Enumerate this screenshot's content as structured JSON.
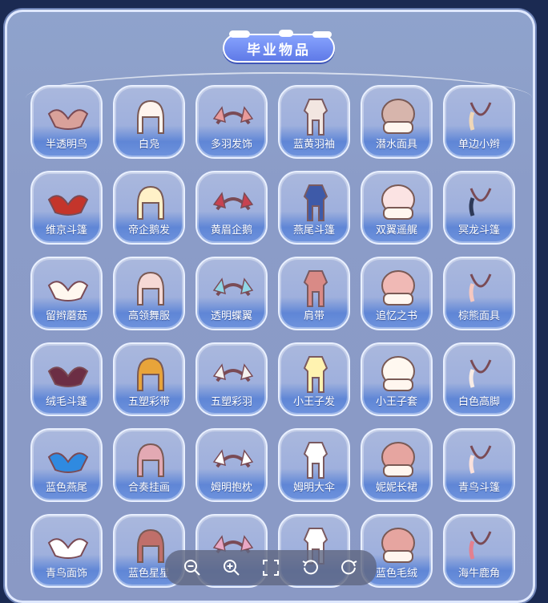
{
  "panel": {
    "title": "毕业物品"
  },
  "items": [
    {
      "label": "半透明鸟",
      "icon": "translucent-bird-icon",
      "color": "#d9a19a"
    },
    {
      "label": "白凫",
      "icon": "white-hair-icon",
      "color": "#fff5ee"
    },
    {
      "label": "多羽发饰",
      "icon": "feather-headband-icon",
      "color": "#e89a9a"
    },
    {
      "label": "蓝黄羽袖",
      "icon": "outfit-icon",
      "color": "#f2e6e1"
    },
    {
      "label": "潜水面具",
      "icon": "diving-mask-icon",
      "color": "#d7b5ac"
    },
    {
      "label": "单边小辫",
      "icon": "braid-icon",
      "color": "#f0d7b7"
    },
    {
      "label": "维京斗篷",
      "icon": "cape-icon",
      "color": "#c4352b"
    },
    {
      "label": "帝企鹅发",
      "icon": "hair-icon",
      "color": "#fff1c8"
    },
    {
      "label": "黄眉企鹅",
      "icon": "penguin-mask-icon",
      "color": "#c84250"
    },
    {
      "label": "燕尾斗篷",
      "icon": "swallowtail-cape-icon",
      "color": "#3e5aa8"
    },
    {
      "label": "双翼遥艉",
      "icon": "wing-cape-icon",
      "color": "#fbe3e3"
    },
    {
      "label": "冥龙斗篷",
      "icon": "dragon-cape-icon",
      "color": "#2d3958"
    },
    {
      "label": "留辫蘑菇",
      "icon": "mushroom-hair-icon",
      "color": "#fff8ef"
    },
    {
      "label": "高领舞服",
      "icon": "dance-outfit-icon",
      "color": "#f6d9d5"
    },
    {
      "label": "透明蝶翼",
      "icon": "butterfly-wings-icon",
      "color": "#8fd6e6"
    },
    {
      "label": "肩带",
      "icon": "shoulder-strap-icon",
      "color": "#d98a86"
    },
    {
      "label": "追忆之书",
      "icon": "book-icon",
      "color": "#f0b9b5"
    },
    {
      "label": "棕熊面具",
      "icon": "bear-mask-icon",
      "color": "#f6c8c0"
    },
    {
      "label": "绒毛斗篷",
      "icon": "fur-cape-icon",
      "color": "#6c2e44"
    },
    {
      "label": "五塑彩带",
      "icon": "ribbon-icon",
      "color": "#e8a43a"
    },
    {
      "label": "五塑彩羽",
      "icon": "feather-hair-icon",
      "color": "#f4f1ee"
    },
    {
      "label": "小王子发",
      "icon": "little-prince-hair-icon",
      "color": "#fff3b0"
    },
    {
      "label": "小王子套",
      "icon": "little-prince-outfit-icon",
      "color": "#fff8f0"
    },
    {
      "label": "白色高脚",
      "icon": "piano-icon",
      "color": "#f8ece6"
    },
    {
      "label": "蓝色燕尾",
      "icon": "blue-swallowtail-icon",
      "color": "#2f8ae0"
    },
    {
      "label": "合奏挂画",
      "icon": "painting-icon",
      "color": "#e3a9b3"
    },
    {
      "label": "姆明抱枕",
      "icon": "moomin-pillow-icon",
      "color": "#ffffff"
    },
    {
      "label": "姆明大伞",
      "icon": "umbrella-icon",
      "color": "#ffffff"
    },
    {
      "label": "妮妮长裙",
      "icon": "dress-icon",
      "color": "#e6a5a0"
    },
    {
      "label": "青鸟斗篷",
      "icon": "bluebird-cape-icon",
      "color": "#fae1dc"
    },
    {
      "label": "青鸟面饰",
      "icon": "bluebird-face-icon",
      "color": "#ffffff"
    },
    {
      "label": "蓝色星星",
      "icon": "star-accessory-icon",
      "color": "#c06f6a"
    },
    {
      "label": "",
      "icon": "cape-icon",
      "color": "#e9a7c4"
    },
    {
      "label": "",
      "icon": "scarf-icon",
      "color": "#ffffff"
    },
    {
      "label": "蓝色毛绒",
      "icon": "plush-outfit-icon",
      "color": "#e6a5a0"
    },
    {
      "label": "海牛鹿角",
      "icon": "antler-icon",
      "color": "#e3808f"
    }
  ],
  "toolbar": {
    "buttons": [
      {
        "name": "zoom-out-button",
        "icon": "zoom-out-icon"
      },
      {
        "name": "zoom-in-button",
        "icon": "zoom-in-icon"
      },
      {
        "name": "fit-screen-button",
        "icon": "fullscreen-icon"
      },
      {
        "name": "rotate-left-button",
        "icon": "rotate-left-icon"
      },
      {
        "name": "rotate-right-button",
        "icon": "rotate-right-icon"
      }
    ]
  },
  "colors": {
    "panel": "#8fa3cc",
    "title_bg": "#6a85ee",
    "tile_bottom": "#5f86d6",
    "toolbar": "#606882"
  }
}
